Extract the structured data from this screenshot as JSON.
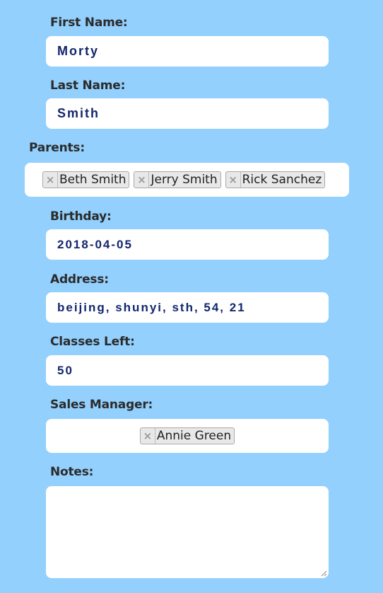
{
  "form": {
    "first_name": {
      "label": "First Name:",
      "value": "Morty"
    },
    "last_name": {
      "label": "Last Name:",
      "value": "Smith"
    },
    "parents": {
      "label": "Parents:",
      "tags": [
        "Beth Smith",
        "Jerry Smith",
        "Rick Sanchez"
      ]
    },
    "birthday": {
      "label": "Birthday:",
      "value": "2018-04-05"
    },
    "address": {
      "label": "Address:",
      "value": "beijing, shunyi, sth, 54, 21"
    },
    "classes_left": {
      "label": "Classes Left:",
      "value": "50"
    },
    "sales_manager": {
      "label": "Sales Manager:",
      "tags": [
        "Annie Green"
      ]
    },
    "notes": {
      "label": "Notes:",
      "value": ""
    }
  },
  "icons": {
    "tag_remove": "×"
  },
  "colors": {
    "background": "#93d0fd",
    "field_background": "#ffffff",
    "value_text": "#13266d",
    "label_text": "#2b2b2b"
  }
}
